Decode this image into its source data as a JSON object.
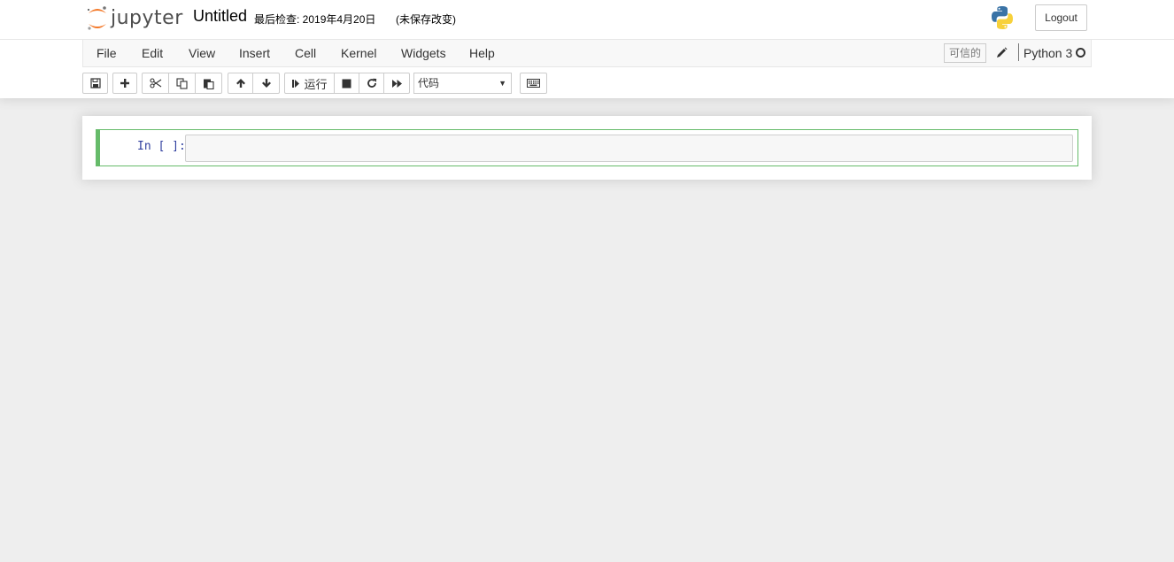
{
  "header": {
    "logo_text": "jupyter",
    "notebook_name": "Untitled",
    "checkpoint": "最后检查: 2019年4月20日",
    "autosave_status": "(未保存改变)",
    "logout_label": "Logout"
  },
  "menubar": {
    "items": [
      "File",
      "Edit",
      "View",
      "Insert",
      "Cell",
      "Kernel",
      "Widgets",
      "Help"
    ],
    "trusted_label": "可信的",
    "kernel_name": "Python 3"
  },
  "toolbar": {
    "run_label": "运行",
    "cell_type_selected": "代码"
  },
  "cell": {
    "prompt": "In [ ]:"
  },
  "colors": {
    "accent_green": "#66bb6a",
    "logo_orange": "#f37726",
    "prompt_blue": "#303f9f"
  }
}
